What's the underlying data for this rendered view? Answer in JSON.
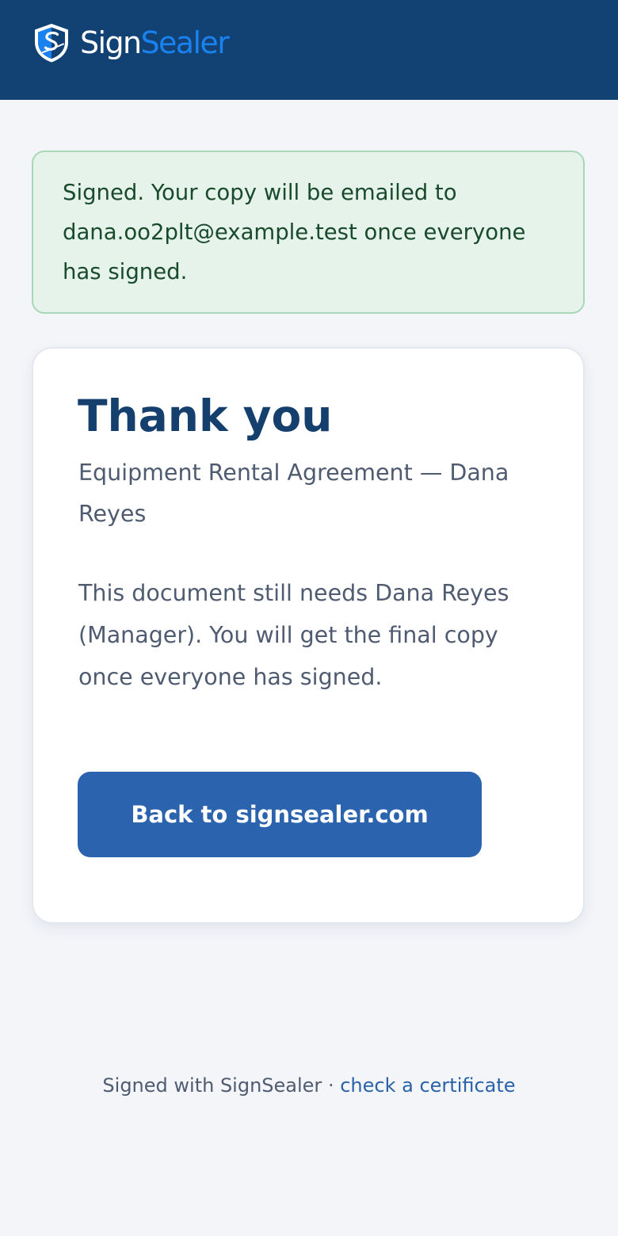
{
  "header": {
    "brand_part1": "Sign",
    "brand_part2": "Sealer",
    "brand_color": "#1a82ee",
    "background": "#124173",
    "icon": "shield-logo-icon"
  },
  "alert": {
    "message": "Signed. Your copy will be emailed to dana.oo2plt@example.test once everyone has signed.",
    "status": "success",
    "background": "#e5f3ea"
  },
  "card": {
    "title": "Thank you",
    "subtitle": "Equipment Rental Agreement — Dana Reyes",
    "body": "This document still needs Dana Reyes (Manager). You will get the final copy once everyone has signed.",
    "button_label": "Back to signsealer.com",
    "button_color": "#2b63ae"
  },
  "footer": {
    "prefix": "Signed with SignSealer",
    "separator": "·",
    "link_label": "check a certificate"
  }
}
